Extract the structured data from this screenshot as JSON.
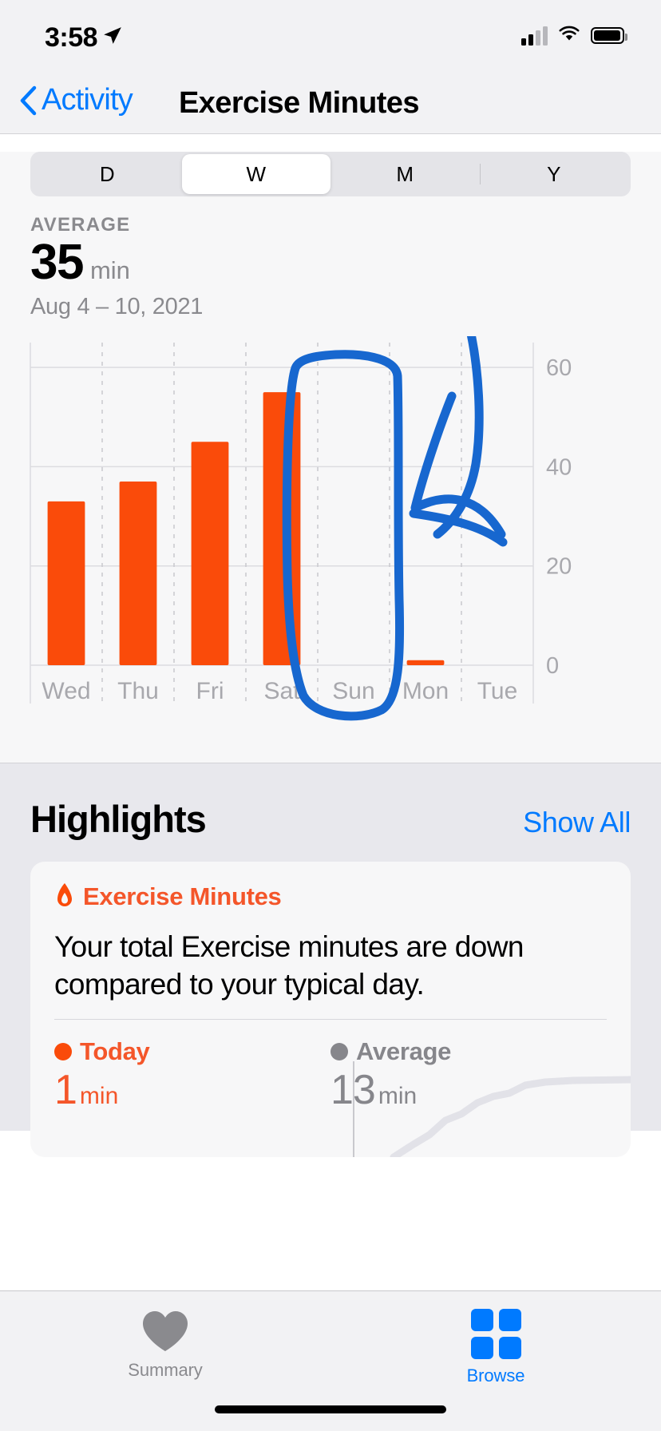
{
  "status_bar": {
    "time": "3:58",
    "location_icon": "location-arrow-icon",
    "cellular_icon": "cellular-bars-icon",
    "wifi_icon": "wifi-icon",
    "battery_icon": "battery-icon"
  },
  "nav": {
    "back_label": "Activity",
    "back_icon": "chevron-left-icon",
    "title": "Exercise Minutes"
  },
  "segmented": {
    "options": [
      "D",
      "W",
      "M",
      "Y"
    ],
    "selected": "W"
  },
  "summary": {
    "stat_label": "AVERAGE",
    "value": "35",
    "unit": "min",
    "range": "Aug 4 – 10, 2021"
  },
  "chart_data": {
    "type": "bar",
    "title": "Exercise Minutes",
    "xlabel": "",
    "ylabel": "min",
    "categories": [
      "Wed",
      "Thu",
      "Fri",
      "Sat",
      "Sun",
      "Mon",
      "Tue"
    ],
    "values": [
      33,
      37,
      45,
      55,
      0,
      1,
      0
    ],
    "ylim": [
      0,
      65
    ],
    "yticks": [
      0,
      20,
      40,
      60
    ],
    "ytick_labels": [
      "0",
      "20",
      "40",
      "60"
    ],
    "grid": true,
    "bar_color": "#fa4b0a",
    "legend": "none"
  },
  "annotations": {
    "ink_color": "#1767cf",
    "marks": [
      "circle-around-sun-mon",
      "check-scribble-right"
    ]
  },
  "highlights": {
    "title": "Highlights",
    "show_all_label": "Show All",
    "card": {
      "icon": "flame-icon",
      "title": "Exercise Minutes",
      "body": "Your total Exercise minutes are down compared to your typical day.",
      "stats": [
        {
          "label": "Today",
          "value": "1",
          "unit": "min",
          "color": "#f4562a"
        },
        {
          "label": "Average",
          "value": "13",
          "unit": "min",
          "color": "#86868b"
        }
      ]
    }
  },
  "tabbar": {
    "tabs": [
      {
        "label": "Summary",
        "icon": "heart-icon",
        "selected": false
      },
      {
        "label": "Browse",
        "icon": "grid-icon",
        "selected": true
      }
    ]
  },
  "colors": {
    "accent_blue": "#007aff",
    "orange": "#fa4b0a",
    "gray_text": "#8a8a8e"
  }
}
